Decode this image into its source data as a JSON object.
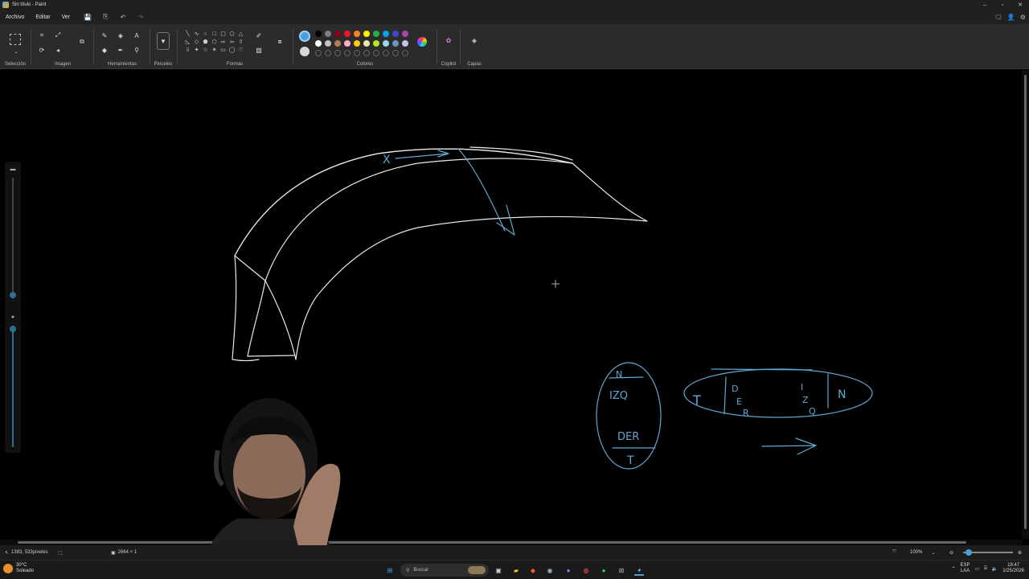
{
  "window": {
    "title": "Sin título - Paint"
  },
  "menu": {
    "file": "Archivo",
    "edit": "Editar",
    "view": "Ver"
  },
  "ribbon": {
    "groups": {
      "selection": "Selección",
      "image": "Imagen",
      "tools": "Herramientas",
      "brushes": "Pinceles",
      "shapes": "Formas",
      "colors": "Colores",
      "copilot": "Copilot",
      "layers": "Capas"
    },
    "text_tool_glyph": "A"
  },
  "colors": {
    "primary": "#4a9fd8",
    "secondary": "#d9d9d9",
    "row1": [
      "#000000",
      "#7f7f7f",
      "#880015",
      "#ed1c24",
      "#ff7f27",
      "#fff200",
      "#22b14c",
      "#00a2e8",
      "#3f48cc",
      "#a349a4"
    ],
    "row2": [
      "#ffffff",
      "#c3c3c3",
      "#b97a57",
      "#ffaec9",
      "#ffc90e",
      "#efe4b0",
      "#b5e61d",
      "#99d9ea",
      "#7092be",
      "#c8bfe7"
    ]
  },
  "canvas": {
    "stroke_colors": {
      "white": "#e8e8e8",
      "blue": "#5fa8d3"
    },
    "annotations": {
      "oval1_top": "N",
      "oval1_izq": "IZQ",
      "oval1_der": "DER",
      "oval1_bottom": "T",
      "oval2_t": "T",
      "oval2_d": "D",
      "oval2_e": "E",
      "oval2_r": "R",
      "oval2_i": "I",
      "oval2_z": "Z",
      "oval2_q": "Q",
      "oval2_n": "N",
      "arrow_x": "X"
    }
  },
  "statusbar": {
    "cursor_pos": "1383, 533píxeles",
    "canvas_size": "2664 × 1",
    "zoom": "100%"
  },
  "taskbar": {
    "weather_temp": "30°C",
    "weather_desc": "Soleado",
    "search_placeholder": "Buscar",
    "lang_top": "ESP",
    "lang_bottom": "LAA",
    "time": "18:47",
    "date": "1/25/2026"
  }
}
